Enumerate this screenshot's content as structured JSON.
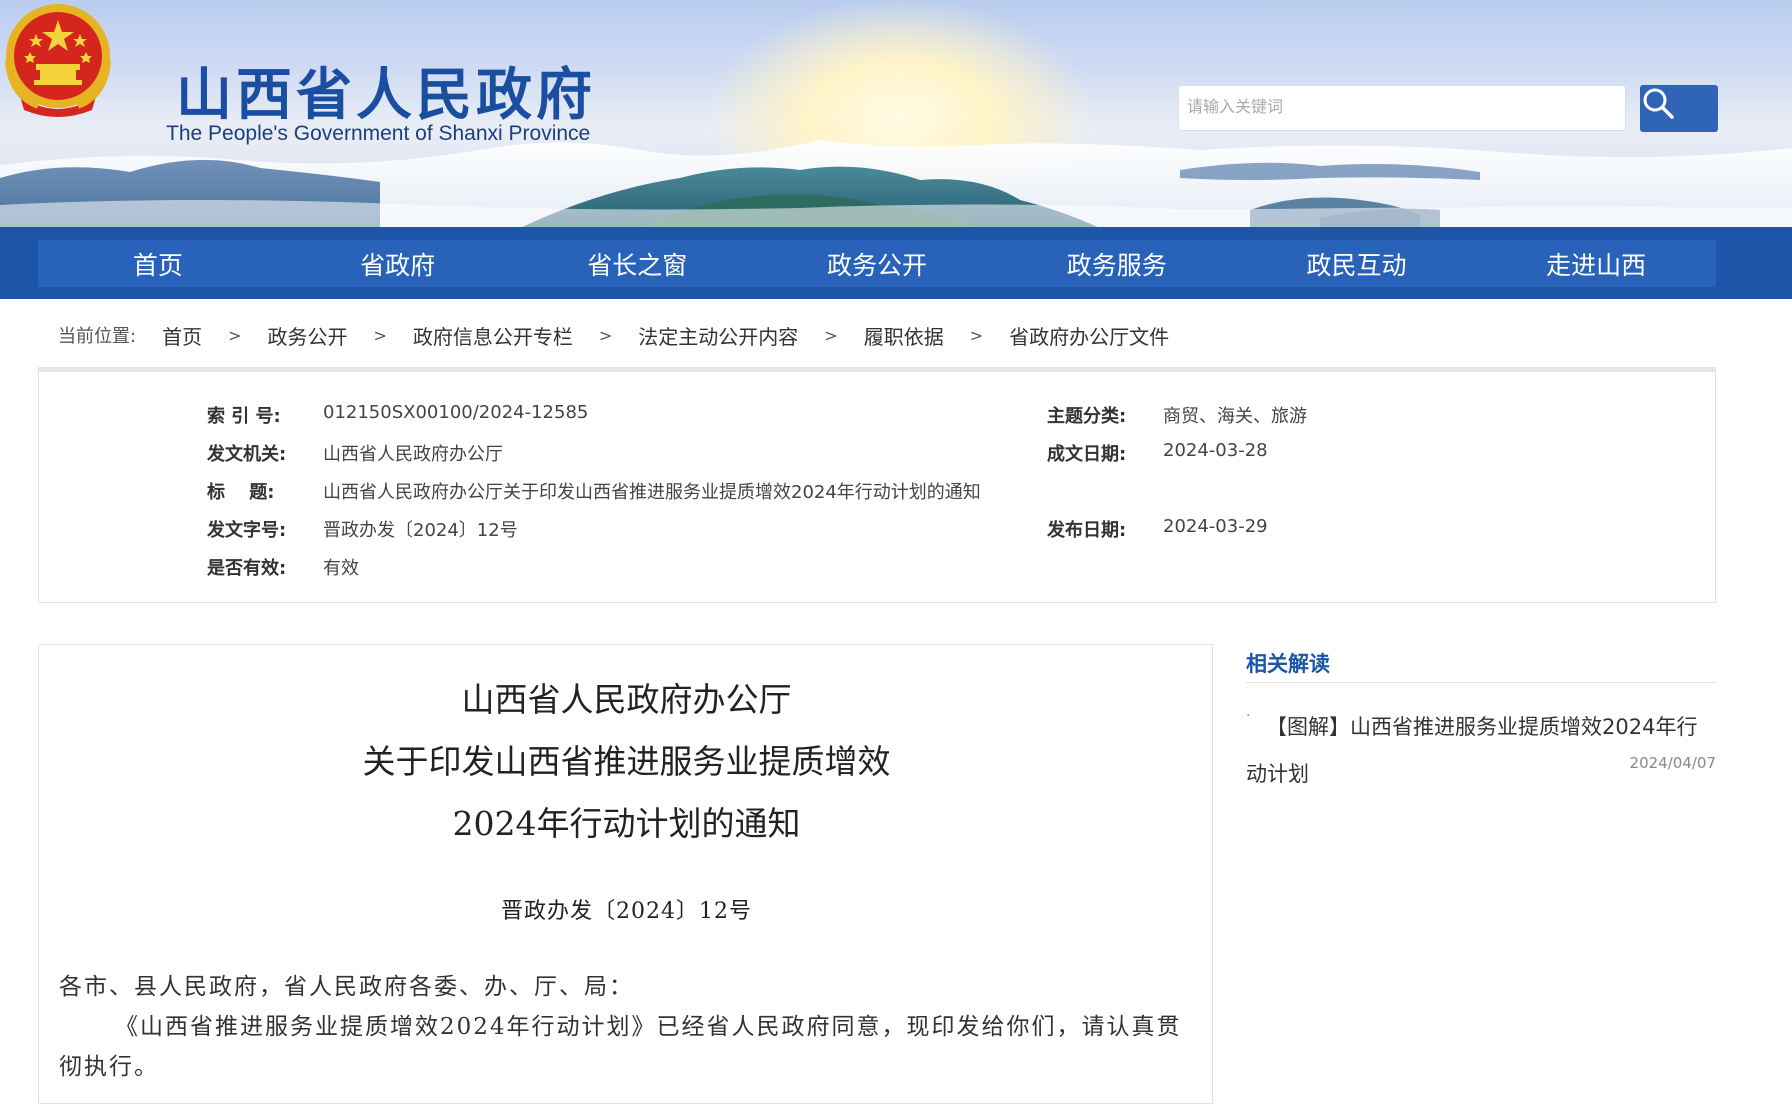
{
  "header": {
    "site_title": "山西省人民政府",
    "site_subtitle": "The People's Government of Shanxi Province",
    "search_placeholder": "请输入关键词",
    "search_icon": "search-icon",
    "emblem_icon": "national-emblem-icon"
  },
  "nav": {
    "items": [
      "首页",
      "省政府",
      "省长之窗",
      "政务公开",
      "政务服务",
      "政民互动",
      "走进山西"
    ]
  },
  "breadcrumb": {
    "label": "当前位置:",
    "items": [
      "首页",
      "政务公开",
      "政府信息公开专栏",
      "法定主动公开内容",
      "履职依据",
      "省政府办公厅文件"
    ],
    "separator": ">"
  },
  "info": {
    "index_label": "索 引 号:",
    "index_value": "012150SX00100/2024-12585",
    "issuer_label": "发文机关:",
    "issuer_value": "山西省人民政府办公厅",
    "title_label": "标　 题:",
    "title_value": "山西省人民政府办公厅关于印发山西省推进服务业提质增效2024年行动计划的通知",
    "docno_label": "发文字号:",
    "docno_value": "晋政办发〔2024〕12号",
    "valid_label": "是否有效:",
    "valid_value": "有效",
    "topic_label": "主题分类:",
    "topic_value": "商贸、海关、旅游",
    "created_label": "成文日期:",
    "created_value": "2024-03-28",
    "published_label": "发布日期:",
    "published_value": "2024-03-29"
  },
  "article": {
    "title_line1": "山西省人民政府办公厅",
    "title_line2": "关于印发山西省推进服务业提质增效",
    "title_line3": "2024年行动计划的通知",
    "doc_number": "晋政办发〔2024〕12号",
    "salutation": "各市、县人民政府，省人民政府各委、办、厅、局：",
    "body": "《山西省推进服务业提质增效2024年行动计划》已经省人民政府同意，现印发给你们，请认真贯彻执行。"
  },
  "sidebar": {
    "related_title": "相关解读",
    "items": [
      {
        "text_part1": "【图解】山西省推进服务业提质增效2024年行",
        "text_part2": "动计划",
        "date": "2024/04/07",
        "bullet": "·"
      }
    ]
  },
  "colors": {
    "nav_blue": "#1d55a8",
    "title_blue": "#1a4ea0",
    "search_button": "#2f64b7"
  }
}
